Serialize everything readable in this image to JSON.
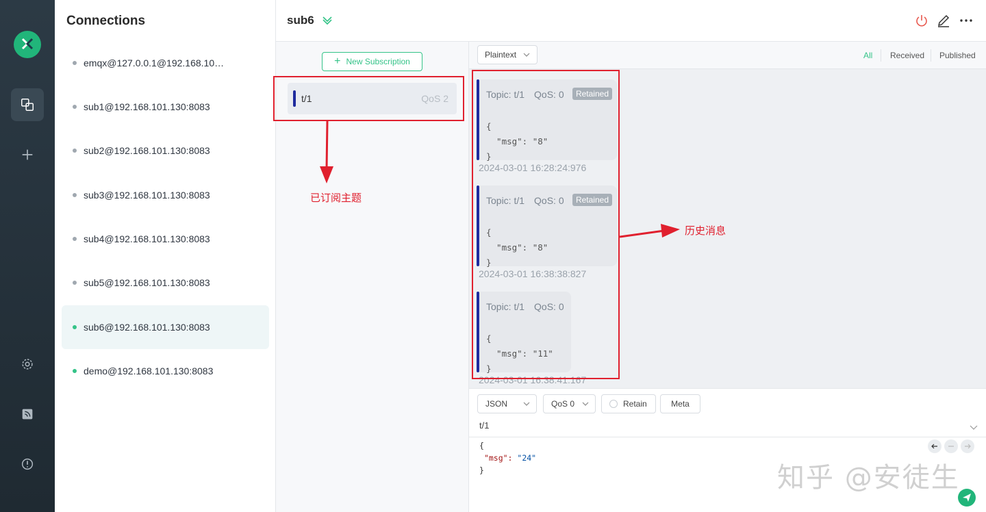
{
  "connections": {
    "title": "Connections",
    "items": [
      {
        "name": "emqx@127.0.0.1@192.168.101....",
        "online": false
      },
      {
        "name": "sub1@192.168.101.130:8083",
        "online": false
      },
      {
        "name": "sub2@192.168.101.130:8083",
        "online": false
      },
      {
        "name": "sub3@192.168.101.130:8083",
        "online": false
      },
      {
        "name": "sub4@192.168.101.130:8083",
        "online": false
      },
      {
        "name": "sub5@192.168.101.130:8083",
        "online": false
      },
      {
        "name": "sub6@192.168.101.130:8083",
        "online": true
      },
      {
        "name": "demo@192.168.101.130:8083",
        "online": true
      }
    ]
  },
  "header": {
    "title": "sub6"
  },
  "subscriptions": {
    "new_label": "New Subscription",
    "items": [
      {
        "topic": "t/1",
        "qos": "QoS 2",
        "color": "#1f2b9e"
      }
    ]
  },
  "messages": {
    "format": "Plaintext",
    "filters": {
      "all": "All",
      "received": "Received",
      "published": "Published"
    },
    "items": [
      {
        "topic": "Topic: t/1",
        "qos": "QoS: 0",
        "retained": "Retained",
        "body": [
          "{",
          "  \"msg\": \"8\"",
          "}"
        ],
        "time": "2024-03-01 16:28:24:976"
      },
      {
        "topic": "Topic: t/1",
        "qos": "QoS: 0",
        "retained": "Retained",
        "body": [
          "{",
          "  \"msg\": \"8\"",
          "}"
        ],
        "time": "2024-03-01 16:38:38:827"
      },
      {
        "topic": "Topic: t/1",
        "qos": "QoS: 0",
        "retained": "",
        "body": [
          "{",
          "  \"msg\": \"11\"",
          "}"
        ],
        "time": "2024-03-01 16:38:41:167"
      }
    ]
  },
  "composer": {
    "format": "JSON",
    "qos": "QoS 0",
    "retain": "Retain",
    "meta": "Meta",
    "topic": "t/1",
    "payload_lines": [
      "{",
      "\"msg\": \"24\"",
      "}"
    ]
  },
  "annotations": {
    "subscribed_topic": "已订阅主题",
    "history_messages": "历史消息"
  },
  "watermark": "知乎 @安徒生",
  "colors": {
    "accent": "#34c388",
    "annotation": "#e0202e",
    "topic_bar": "#1f2b9e"
  }
}
